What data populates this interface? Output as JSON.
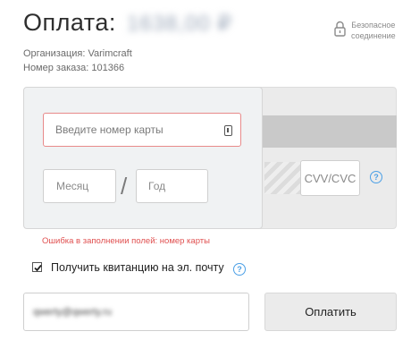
{
  "header": {
    "title": "Оплата:",
    "amount": "1638,00 ₽",
    "secure_line1": "Безопасное",
    "secure_line2": "соединение"
  },
  "order": {
    "organization": "Организация: Varimcraft",
    "order_number": "Номер заказа: 101366"
  },
  "card_form": {
    "card_number_placeholder": "Введите номер карты",
    "month_placeholder": "Месяц",
    "separator": "/",
    "year_placeholder": "Год",
    "cvv_placeholder": "CVV/CVC",
    "error_text": "Ошибка в заполнении полей: номер карты"
  },
  "receipt": {
    "checked": true,
    "label": "Получить квитанцию на эл. почту",
    "email_value": "qwerty@qwerty.ru"
  },
  "actions": {
    "pay_label": "Оплатить"
  },
  "colors": {
    "error": "#e05050",
    "help_accent": "#4a9fe6"
  },
  "icons": [
    "lock-icon",
    "card-scan-icon",
    "help-icon",
    "checkbox-checked-icon"
  ]
}
